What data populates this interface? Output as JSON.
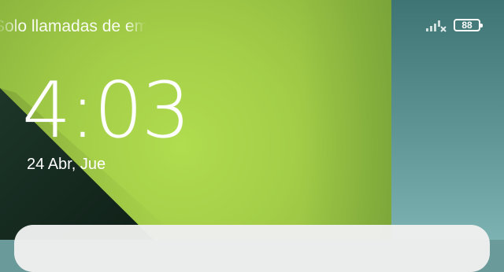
{
  "status_bar": {
    "notification_text": "Solo llamadas de emergencia",
    "signal_icon": "signal-no-service-icon",
    "battery_icon": "battery-icon",
    "battery_level": "88"
  },
  "lockscreen": {
    "time": "4:03",
    "date": "24 Abr, Jue"
  },
  "colors": {
    "wallpaper_green": "#a9d24e",
    "wallpaper_teal": "#5e9494",
    "wallpaper_dark": "#13251c",
    "card_background": "#eeefee"
  }
}
